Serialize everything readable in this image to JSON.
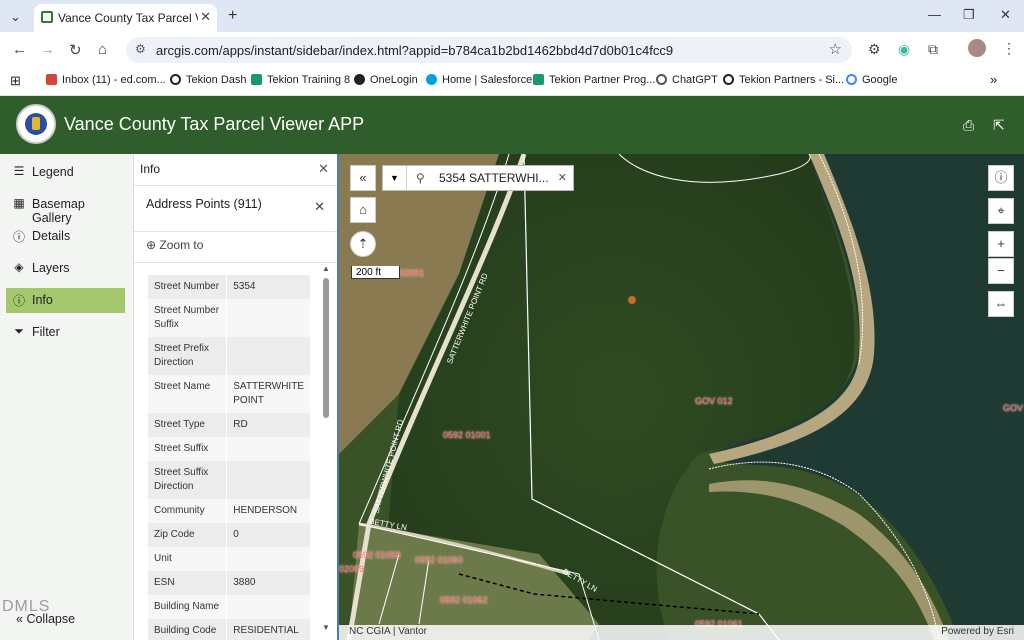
{
  "browser": {
    "tab_title": "Vance County Tax Parcel Viewer",
    "url": "arcgis.com/apps/instant/sidebar/index.html?appid=b784ca1b2bd1462bbd4d7d0b01c4fcc9",
    "bookmarks": [
      {
        "label": "Inbox (11) - ed.com...",
        "color": "#d44638"
      },
      {
        "label": "Tekion Dash",
        "color": "#222"
      },
      {
        "label": "Tekion Training 8",
        "color": "#1a9a6c"
      },
      {
        "label": "OneLogin",
        "color": "#222"
      },
      {
        "label": "Home | Salesforce",
        "color": "#00a1e0"
      },
      {
        "label": "Tekion Partner Prog...",
        "color": "#1a9a6c"
      },
      {
        "label": "ChatGPT",
        "color": "#555"
      },
      {
        "label": "Tekion Partners - Si...",
        "color": "#222"
      },
      {
        "label": "Google",
        "color": "#4285f4"
      }
    ]
  },
  "app": {
    "title": "Vance County Tax Parcel Viewer APP",
    "header_color": "#2f5d2b"
  },
  "sidebar": {
    "items": [
      {
        "label": "Legend",
        "icon": "list-icon"
      },
      {
        "label": "Basemap Gallery",
        "icon": "grid-icon"
      },
      {
        "label": "Details",
        "icon": "info-icon"
      },
      {
        "label": "Layers",
        "icon": "layers-icon"
      },
      {
        "label": "Info",
        "icon": "info-icon",
        "active": true
      },
      {
        "label": "Filter",
        "icon": "filter-icon"
      }
    ],
    "collapse_label": "Collapse",
    "watermark": "DMLS"
  },
  "panel": {
    "title": "Info",
    "subtitle": "Address Points (911)",
    "zoom_label": "Zoom to",
    "rows": [
      {
        "k": "Street Number",
        "v": "5354"
      },
      {
        "k": "Street Number Suffix",
        "v": ""
      },
      {
        "k": "Street Prefix Direction",
        "v": ""
      },
      {
        "k": "Street Name",
        "v": "SATTERWHITE POINT"
      },
      {
        "k": "Street Type",
        "v": "RD"
      },
      {
        "k": "Street Suffix",
        "v": ""
      },
      {
        "k": "Street Suffix Direction",
        "v": ""
      },
      {
        "k": "Community",
        "v": "HENDERSON"
      },
      {
        "k": "Zip Code",
        "v": "0"
      },
      {
        "k": "Unit",
        "v": ""
      },
      {
        "k": "ESN",
        "v": "3880"
      },
      {
        "k": "Building Name",
        "v": ""
      },
      {
        "k": "Building Code",
        "v": "RESIDENTIAL"
      }
    ]
  },
  "map": {
    "search_text": "5354 SATTERWHI...",
    "scale_label": "200 ft",
    "attribution_left": "NC CGIA | Vantor",
    "attribution_right": "Powered by Esri",
    "parcel_labels": [
      "02001",
      "GOV 012",
      "GOV",
      "0592 01001",
      "0592 01058",
      "0592 01060",
      "02009",
      "0592 01062",
      "0592 01061"
    ],
    "road_labels": [
      "SATTERWHITE POINT RD",
      "SATTERWHITE POINT RD",
      "BETTY LN",
      "BETTY LN"
    ]
  }
}
